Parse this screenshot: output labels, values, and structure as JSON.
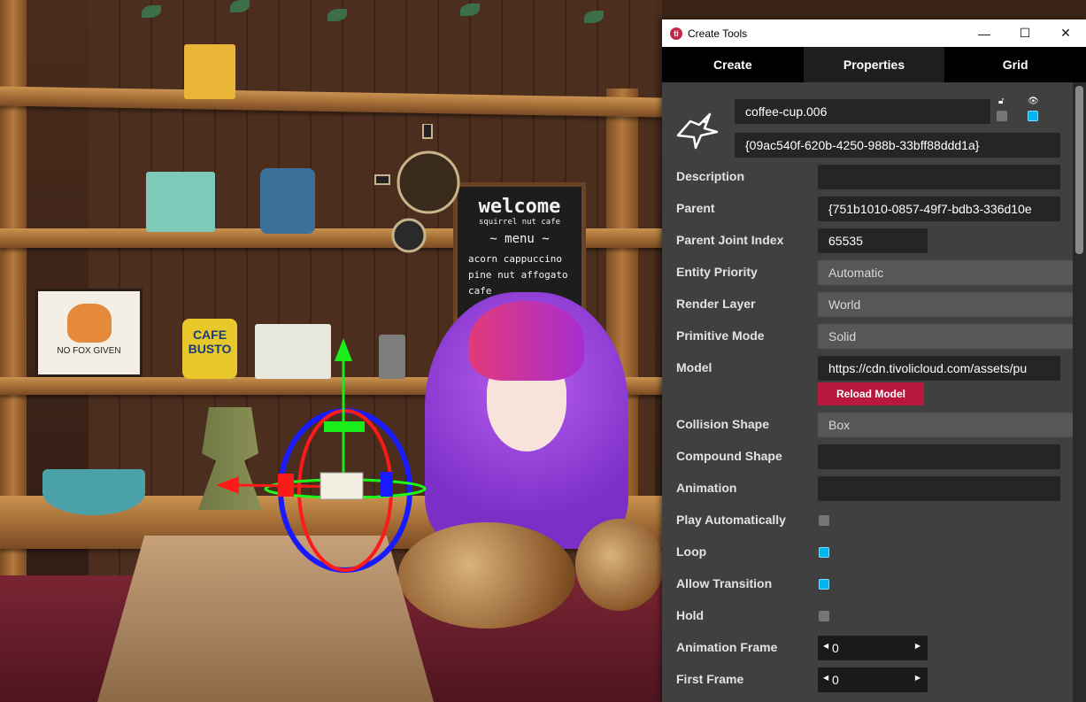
{
  "scene": {
    "sign": {
      "title": "welcome",
      "subtitle": "squirrel nut cafe",
      "menu": "~ menu ~",
      "items": [
        "acorn cappuccino",
        "pine nut affogato",
        "cafe"
      ]
    },
    "poster": {
      "text": "NO FOX GIVEN"
    },
    "can": {
      "text": "CAFE BUSTO"
    }
  },
  "window": {
    "title": "Create Tools",
    "app_icon": "ti",
    "controls": {
      "minimize": "—",
      "maximize": "☐",
      "close": "✕"
    },
    "tabs": [
      {
        "label": "Create",
        "active": false
      },
      {
        "label": "Properties",
        "active": true
      },
      {
        "label": "Grid",
        "active": false
      }
    ]
  },
  "entity": {
    "icon": "bird-logo-icon",
    "name": "coffee-cup.006",
    "id": "{09ac540f-620b-4250-988b-33bff88ddd1a}",
    "locked": false,
    "visible": true
  },
  "properties": {
    "description": {
      "label": "Description",
      "value": ""
    },
    "parent": {
      "label": "Parent",
      "value": "{751b1010-0857-49f7-bdb3-336d10e"
    },
    "parent_joint_index": {
      "label": "Parent Joint Index",
      "value": "65535"
    },
    "entity_priority": {
      "label": "Entity Priority",
      "value": "Automatic"
    },
    "render_layer": {
      "label": "Render Layer",
      "value": "World"
    },
    "primitive_mode": {
      "label": "Primitive Mode",
      "value": "Solid"
    },
    "model": {
      "label": "Model",
      "value": "https://cdn.tivolicloud.com/assets/pu"
    },
    "reload_model": {
      "label": "Reload Model"
    },
    "collision_shape": {
      "label": "Collision Shape",
      "value": "Box"
    },
    "compound_shape": {
      "label": "Compound Shape",
      "value": ""
    },
    "animation": {
      "label": "Animation",
      "value": ""
    },
    "play_automatically": {
      "label": "Play Automatically",
      "checked": false
    },
    "loop": {
      "label": "Loop",
      "checked": true
    },
    "allow_transition": {
      "label": "Allow Transition",
      "checked": true
    },
    "hold": {
      "label": "Hold",
      "checked": false
    },
    "animation_frame": {
      "label": "Animation Frame",
      "value": "0"
    },
    "first_frame": {
      "label": "First Frame",
      "value": "0"
    }
  },
  "colors": {
    "accent": "#00b4ef",
    "button": "#b8183f",
    "panel": "#404040"
  }
}
